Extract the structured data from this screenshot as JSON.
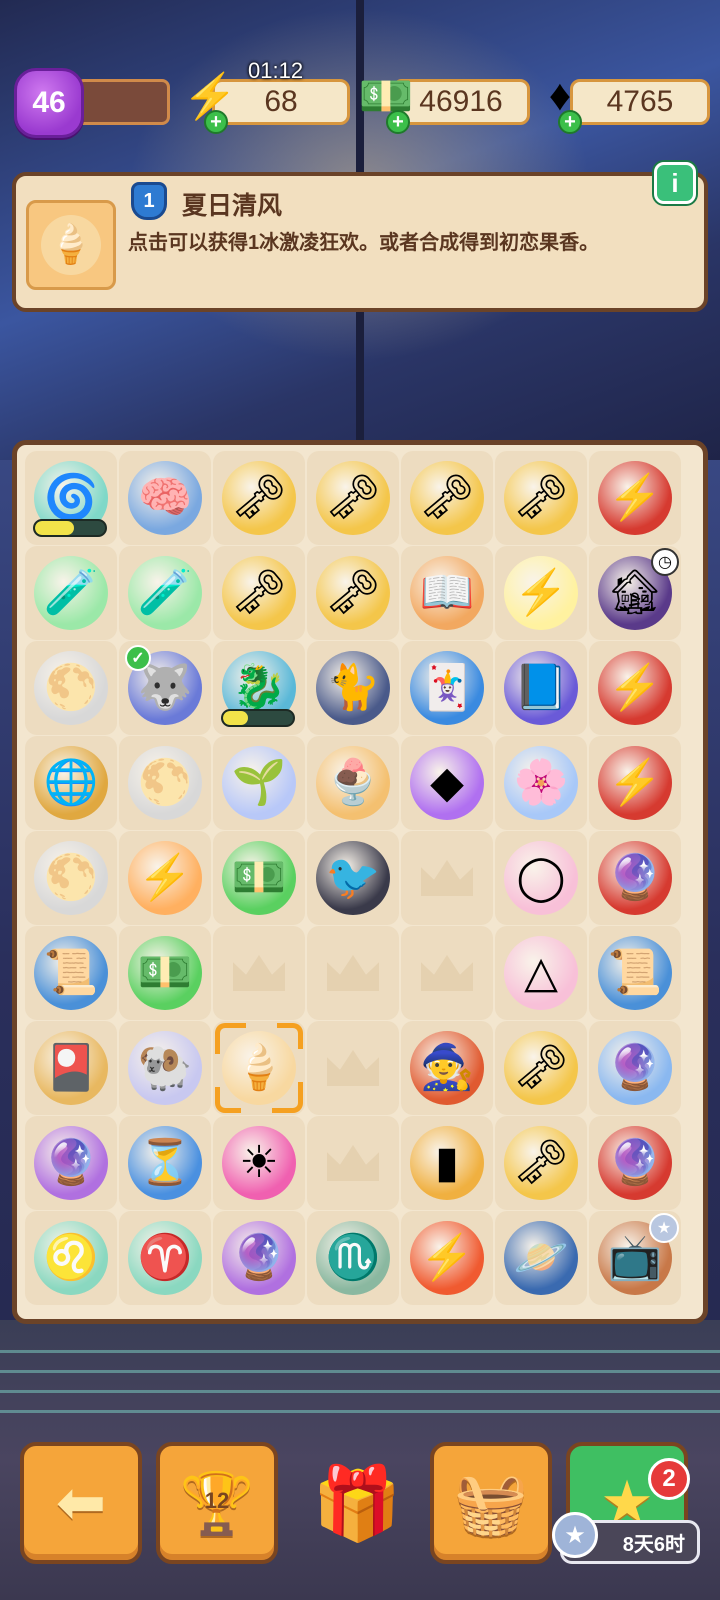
{
  "hud": {
    "level": "46",
    "energy": "68",
    "energy_timer": "01:12",
    "cash": "46916",
    "gems": "4765"
  },
  "info": {
    "tier": "1",
    "title": "夏日清风",
    "description": "点击可以获得1冰激凌狂欢。或者合成得到初恋果香。",
    "info_button": "i"
  },
  "board": [
    [
      {
        "icon": "portal-gate-icon",
        "glyph": "🌀",
        "bg": "#7fd8c8",
        "progress": 0.55
      },
      {
        "icon": "brain-robot-icon",
        "glyph": "🧠",
        "bg": "#7aa8e0"
      },
      {
        "icon": "ruby-key-icon",
        "glyph": "🗝",
        "bg": "#f4c64a"
      },
      {
        "icon": "ruby-key-icon",
        "glyph": "🗝",
        "bg": "#f4c64a"
      },
      {
        "icon": "ruby-key-icon",
        "glyph": "🗝",
        "bg": "#f4c64a"
      },
      {
        "icon": "ruby-key-icon",
        "glyph": "🗝",
        "bg": "#f4c64a"
      },
      {
        "icon": "lightning-witch-icon",
        "glyph": "⚡",
        "bg": "#d63a30"
      }
    ],
    [
      {
        "icon": "potion-tube-icon",
        "glyph": "🧪",
        "bg": "#9be8a8"
      },
      {
        "icon": "potion-tube-icon",
        "glyph": "🧪",
        "bg": "#9be8a8"
      },
      {
        "icon": "ruby-key-icon",
        "glyph": "🗝",
        "bg": "#f4c64a"
      },
      {
        "icon": "ruby-key-icon",
        "glyph": "🗝",
        "bg": "#f4c64a"
      },
      {
        "icon": "reading-girl-icon",
        "glyph": "📖",
        "bg": "#f2a860"
      },
      {
        "icon": "glowing-lightning-orb-icon",
        "glyph": "⚡",
        "bg": "#fff2a0"
      },
      {
        "icon": "haunted-house-icon",
        "glyph": "🏚",
        "bg": "#5a3a8a",
        "clock": true
      }
    ],
    [
      {
        "icon": "moon-orb-icon",
        "glyph": "🌕",
        "bg": "#d8d8d8"
      },
      {
        "icon": "blue-wolf-icon",
        "glyph": "🐺",
        "bg": "#6a7ad8",
        "check": true
      },
      {
        "icon": "water-dragon-icon",
        "glyph": "🐉",
        "bg": "#5ab8d8",
        "progress": 0.35
      },
      {
        "icon": "black-cat-icon",
        "glyph": "🐈",
        "bg": "#4a5a8a"
      },
      {
        "icon": "blue-card-icon",
        "glyph": "🃏",
        "bg": "#3a8ae0"
      },
      {
        "icon": "moon-spellbook-icon",
        "glyph": "📘",
        "bg": "#6a5ad8"
      },
      {
        "icon": "lightning-witch-icon",
        "glyph": "⚡",
        "bg": "#d63a30"
      }
    ],
    [
      {
        "icon": "globe-orrery-icon",
        "glyph": "🌐",
        "bg": "#e0a840"
      },
      {
        "icon": "moon-orb-icon",
        "glyph": "🌕",
        "bg": "#d8d8d8"
      },
      {
        "icon": "sprout-spirit-icon",
        "glyph": "🌱",
        "bg": "#b8c8f8"
      },
      {
        "icon": "fruit-ice-cream-icon",
        "glyph": "🍨",
        "bg": "#f4c070"
      },
      {
        "icon": "purple-gem-icon",
        "glyph": "◆",
        "bg": "#b070f0"
      },
      {
        "icon": "flower-spirit-icon",
        "glyph": "🌸",
        "bg": "#a8c8f8"
      },
      {
        "icon": "lightning-witch-icon",
        "glyph": "⚡",
        "bg": "#d63a30"
      }
    ],
    [
      {
        "icon": "moon-orb-icon",
        "glyph": "🌕",
        "bg": "#d8d8d8"
      },
      {
        "icon": "glowing-lightning-orb-icon",
        "glyph": "⚡",
        "bg": "#ffb060"
      },
      {
        "icon": "cash-stack-icon",
        "glyph": "💵",
        "bg": "#5ad060"
      },
      {
        "icon": "crow-icon",
        "glyph": "🐦",
        "bg": "#3a3a4a"
      },
      {
        "icon": "empty",
        "glyph": "",
        "bg": ""
      },
      {
        "icon": "pink-ring-icon",
        "glyph": "◯",
        "bg": "#f8c0d8"
      },
      {
        "icon": "crystal-ball-girl-icon",
        "glyph": "🔮",
        "bg": "#d63a30"
      }
    ],
    [
      {
        "icon": "blueprint-scroll-icon",
        "glyph": "📜",
        "bg": "#4a90d8"
      },
      {
        "icon": "cash-pile-icon",
        "glyph": "💵",
        "bg": "#5ad060"
      },
      {
        "icon": "empty",
        "glyph": "",
        "bg": ""
      },
      {
        "icon": "empty",
        "glyph": "",
        "bg": ""
      },
      {
        "icon": "empty",
        "glyph": "",
        "bg": ""
      },
      {
        "icon": "pink-triangle-ring-icon",
        "glyph": "△",
        "bg": "#f8c0d8"
      },
      {
        "icon": "blueprint-scroll-icon",
        "glyph": "📜",
        "bg": "#4a90d8"
      }
    ],
    [
      {
        "icon": "tarot-cards-icon",
        "glyph": "🎴",
        "bg": "#e8b860"
      },
      {
        "icon": "ram-spirit-icon",
        "glyph": "🐏",
        "bg": "#c8c8f0"
      },
      {
        "icon": "ice-cream-scoop-icon",
        "glyph": "🍦",
        "bg": "#f8d8a0",
        "selected": true
      },
      {
        "icon": "empty",
        "glyph": "",
        "bg": ""
      },
      {
        "icon": "fire-mage-boy-icon",
        "glyph": "🧙",
        "bg": "#e05a30"
      },
      {
        "icon": "ruby-key-icon",
        "glyph": "🗝",
        "bg": "#f4c64a"
      },
      {
        "icon": "fortune-teller-icon",
        "glyph": "🔮",
        "bg": "#8ab8f0"
      }
    ],
    [
      {
        "icon": "crystal-ball-icon",
        "glyph": "🔮",
        "bg": "#b070e0"
      },
      {
        "icon": "hourglass-gem-icon",
        "glyph": "⏳",
        "bg": "#4a90e0"
      },
      {
        "icon": "sun-moon-orb-icon",
        "glyph": "☀",
        "bg": "#f060b0"
      },
      {
        "icon": "empty",
        "glyph": "",
        "bg": ""
      },
      {
        "icon": "golden-card-icon",
        "glyph": "▮",
        "bg": "#f0b040"
      },
      {
        "icon": "ruby-key-icon",
        "glyph": "🗝",
        "bg": "#f4c64a"
      },
      {
        "icon": "crystal-ball-girl-icon",
        "glyph": "🔮",
        "bg": "#d63a30"
      }
    ],
    [
      {
        "icon": "leo-lion-icon",
        "glyph": "♌",
        "bg": "#8ad8c0"
      },
      {
        "icon": "aries-ram-icon",
        "glyph": "♈",
        "bg": "#8ad8c0"
      },
      {
        "icon": "crystal-ball-icon",
        "glyph": "🔮",
        "bg": "#b070e0"
      },
      {
        "icon": "scorpio-icon",
        "glyph": "♏",
        "bg": "#8ab8a0"
      },
      {
        "icon": "lightning-orb-icon",
        "glyph": "⚡",
        "bg": "#f05a30"
      },
      {
        "icon": "blue-planet-icon",
        "glyph": "🪐",
        "bg": "#3a6ab0"
      },
      {
        "icon": "retro-tv-icon",
        "glyph": "📺",
        "bg": "#c87848",
        "star": true
      }
    ]
  ],
  "bottom": {
    "trophy_count": "12",
    "notification_count": "2",
    "event_timer": "8天6时"
  }
}
